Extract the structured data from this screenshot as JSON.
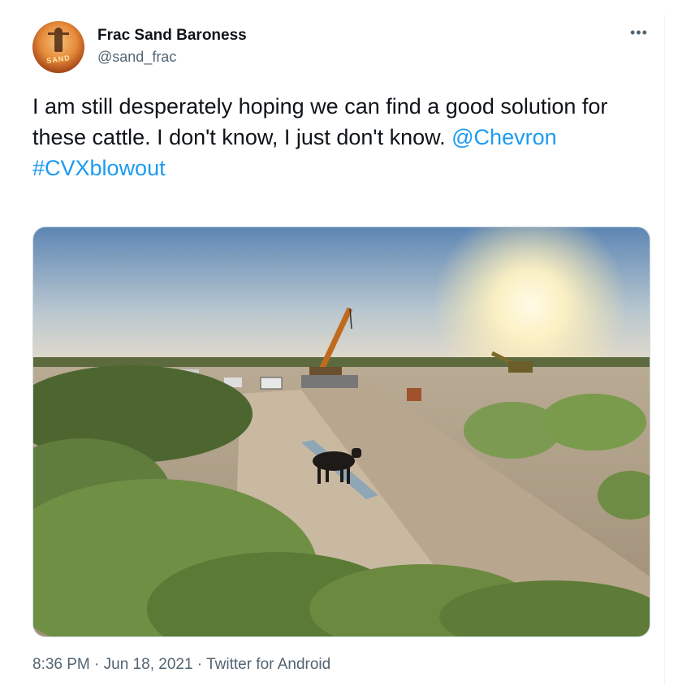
{
  "author": {
    "name": "Frac Sand Baroness",
    "handle": "@sand_frac",
    "avatar_text": "SAND",
    "avatar_icon": "frac-sand-logo-icon"
  },
  "more_icon": "more-horizontal-icon",
  "tweet": {
    "text_line": "I am still desperately hoping we can find a good solution for these cattle. I don't know, I just don't know.",
    "mention": "@Chevron",
    "hashtag": "#CVXblowout"
  },
  "media": {
    "type": "photo",
    "description_icon": "photo-icon"
  },
  "meta": {
    "time": "8:36 PM",
    "separator1": " · ",
    "date": "Jun 18, 2021",
    "separator2": " · ",
    "source": "Twitter for Android"
  },
  "colors": {
    "link": "#1d9bf0",
    "text": "#0f1419",
    "secondary": "#536471"
  }
}
